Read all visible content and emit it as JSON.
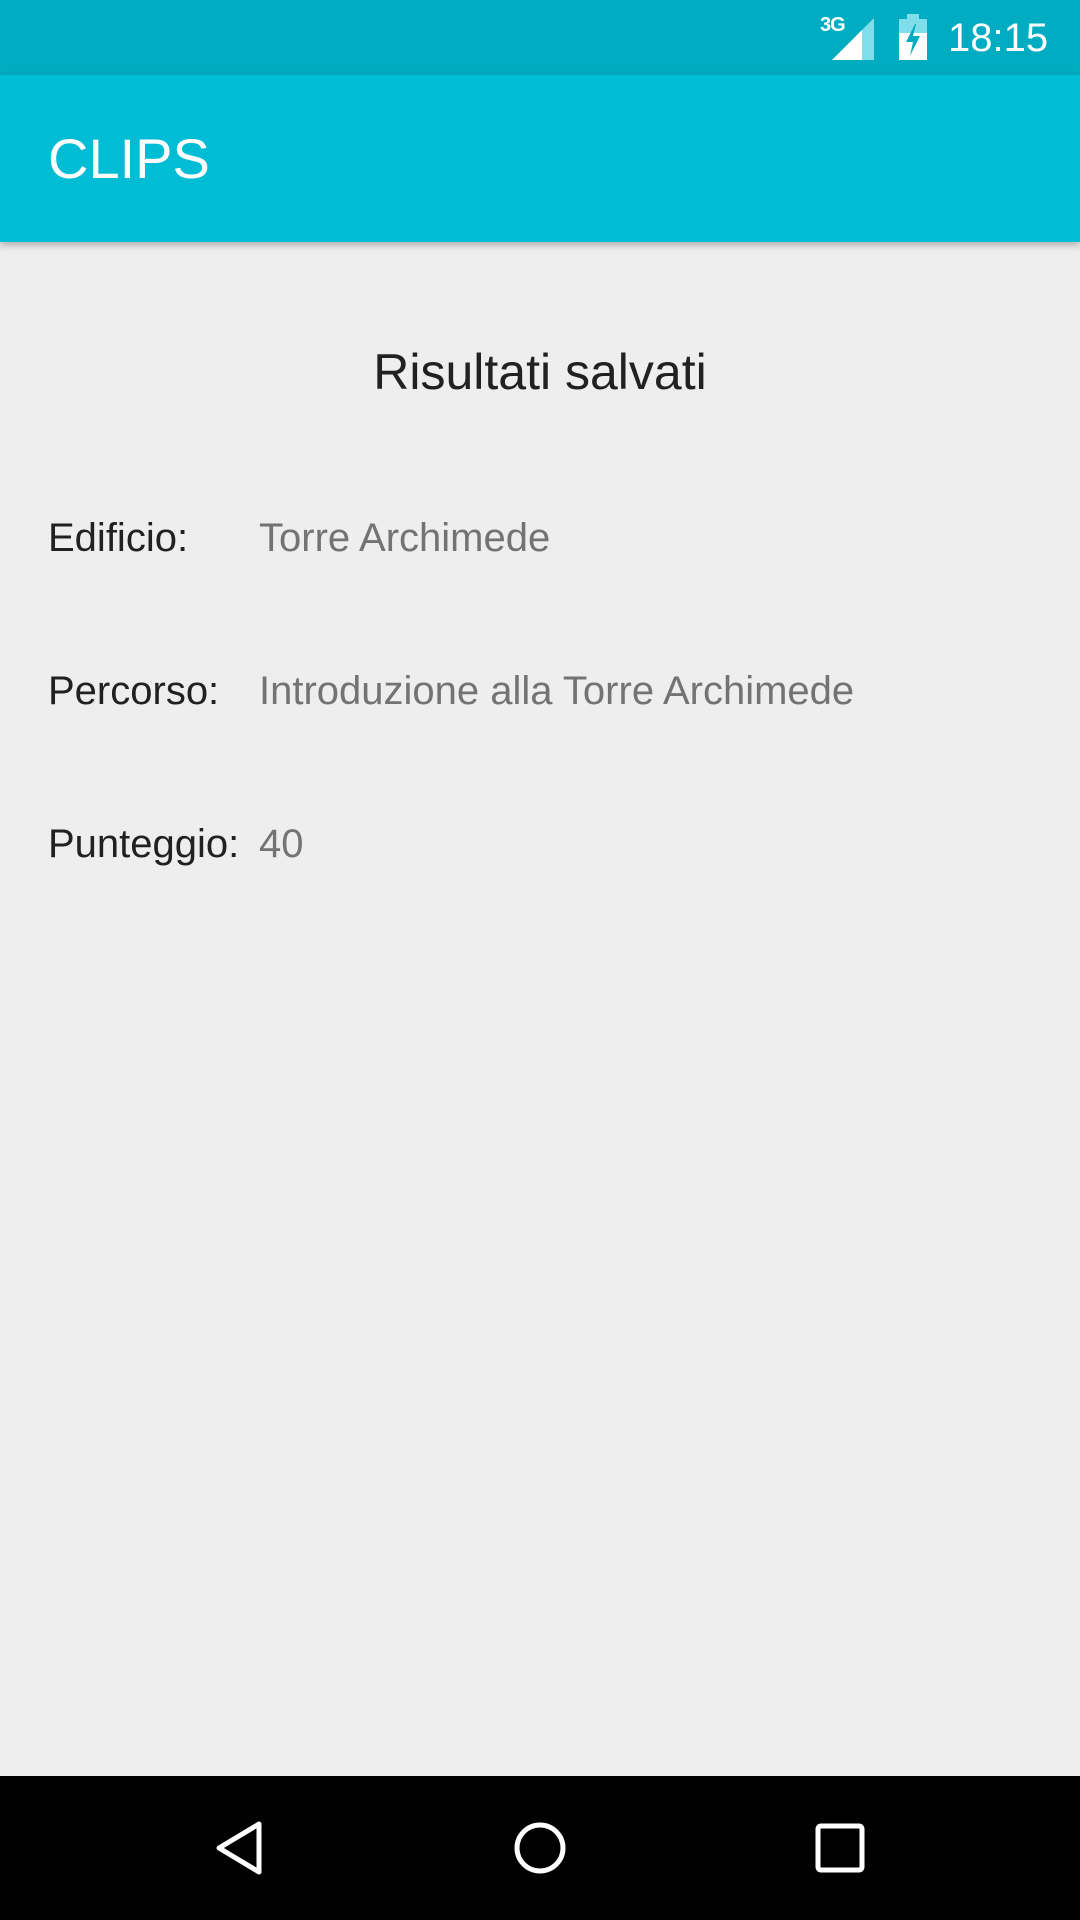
{
  "status_bar": {
    "network_label": "3G",
    "network_icon": "signal-icon",
    "battery_icon": "battery-charging-icon",
    "time": "18:15"
  },
  "app_bar": {
    "title": "CLIPS"
  },
  "main": {
    "heading": "Risultati salvati",
    "fields": {
      "edificio": {
        "label": "Edificio:",
        "value": "Torre Archimede"
      },
      "percorso": {
        "label": "Percorso:",
        "value": "Introduzione alla Torre Archimede"
      },
      "punteggio": {
        "label": "Punteggio:",
        "value": "40"
      }
    }
  },
  "nav_bar": {
    "back_icon": "back-icon",
    "home_icon": "home-icon",
    "recents_icon": "recents-icon"
  },
  "colors": {
    "status_bar": "#00acc1",
    "app_bar": "#00bcd4",
    "background": "#eeeeee",
    "label_text": "#212121",
    "value_text": "#737373",
    "nav_bar": "#000000"
  }
}
